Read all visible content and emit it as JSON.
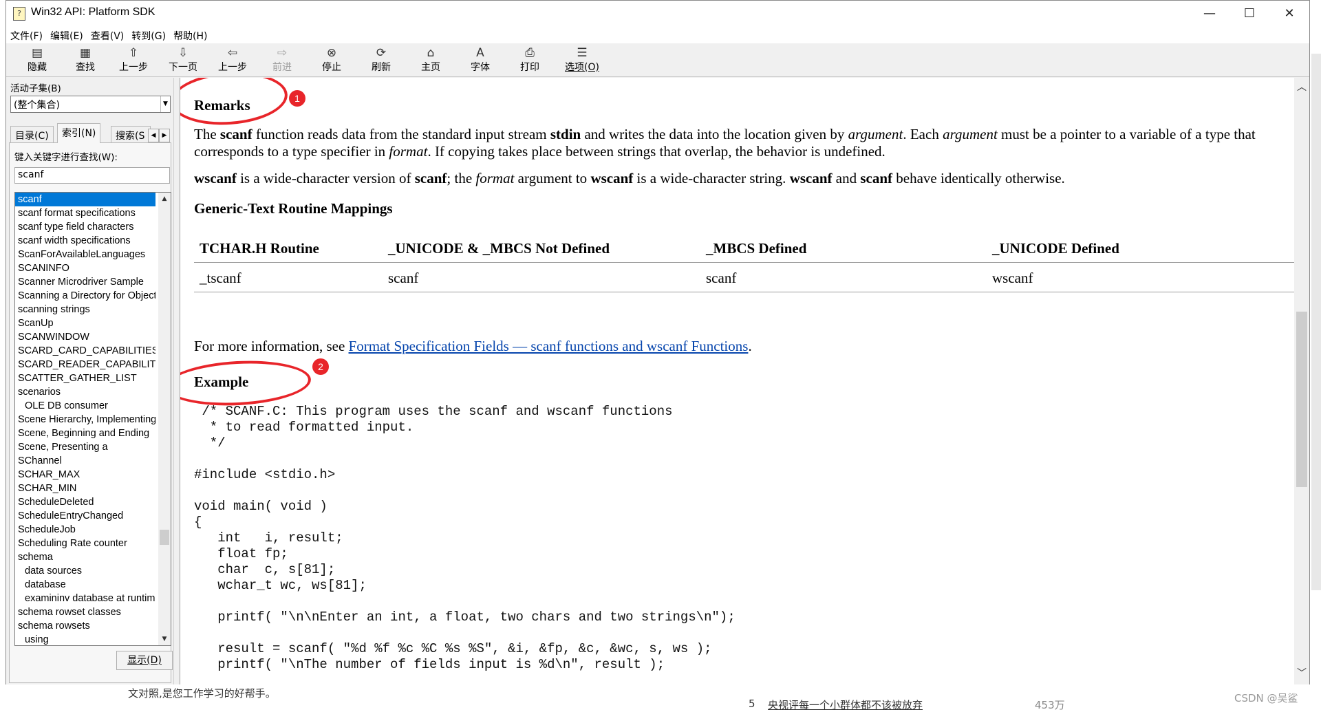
{
  "window": {
    "title": "Win32 API: Platform SDK",
    "controls": {
      "minimize": "—",
      "maximize": "☐",
      "close": "✕"
    }
  },
  "menu": [
    "文件(F)",
    "编辑(E)",
    "查看(V)",
    "转到(G)",
    "帮助(H)"
  ],
  "toolbar": [
    {
      "label": "隐藏",
      "icon": "hide-icon"
    },
    {
      "label": "查找",
      "icon": "locate-icon"
    },
    {
      "label": "上一步",
      "icon": "back-arrow-icon"
    },
    {
      "label": "下一页",
      "icon": "next-page-icon"
    },
    {
      "label": "上一步",
      "icon": "back-icon"
    },
    {
      "label": "前进",
      "icon": "forward-icon",
      "disabled": true
    },
    {
      "label": "停止",
      "icon": "stop-icon"
    },
    {
      "label": "刷新",
      "icon": "refresh-icon"
    },
    {
      "label": "主页",
      "icon": "home-icon"
    },
    {
      "label": "字体",
      "icon": "font-icon"
    },
    {
      "label": "打印",
      "icon": "print-icon"
    },
    {
      "label": "选项(O)",
      "icon": "options-icon"
    }
  ],
  "left": {
    "subset_label": "活动子集(B)",
    "subset_value": "(整个集合)",
    "tabs": [
      "目录(C)",
      "索引(N)",
      "搜索(S"
    ],
    "keyword_label": "键入关键字进行查找(W):",
    "keyword_value": "scanf",
    "index_items": [
      {
        "text": "scanf",
        "selected": true
      },
      {
        "text": "scanf format specifications"
      },
      {
        "text": "scanf type field characters"
      },
      {
        "text": "scanf width specifications"
      },
      {
        "text": "ScanForAvailableLanguages"
      },
      {
        "text": "SCANINFO"
      },
      {
        "text": "Scanner Microdriver Sample"
      },
      {
        "text": "Scanning a Directory for Objects"
      },
      {
        "text": "scanning strings"
      },
      {
        "text": "ScanUp"
      },
      {
        "text": "SCANWINDOW"
      },
      {
        "text": "SCARD_CARD_CAPABILITIES"
      },
      {
        "text": "SCARD_READER_CAPABILITIES"
      },
      {
        "text": "SCATTER_GATHER_LIST"
      },
      {
        "text": "scenarios"
      },
      {
        "text": "OLE DB consumer",
        "indent": true
      },
      {
        "text": "Scene Hierarchy, Implementing"
      },
      {
        "text": "Scene, Beginning and Ending"
      },
      {
        "text": "Scene, Presenting a"
      },
      {
        "text": "SChannel"
      },
      {
        "text": "SCHAR_MAX"
      },
      {
        "text": "SCHAR_MIN"
      },
      {
        "text": "ScheduleDeleted"
      },
      {
        "text": "ScheduleEntryChanged"
      },
      {
        "text": "ScheduleJob"
      },
      {
        "text": "Scheduling Rate counter"
      },
      {
        "text": "schema"
      },
      {
        "text": "data sources",
        "indent": true
      },
      {
        "text": "database",
        "indent": true
      },
      {
        "text": "examininv database at runtime",
        "indent": true
      },
      {
        "text": "schema rowset classes"
      },
      {
        "text": "schema rowsets"
      },
      {
        "text": "using",
        "indent": true
      }
    ],
    "show_button": "显示(D)"
  },
  "content": {
    "remarks_heading": "Remarks",
    "remarks_p1": [
      {
        "t": "The "
      },
      {
        "t": "scanf",
        "b": true
      },
      {
        "t": " function reads data from the standard input stream "
      },
      {
        "t": "stdin",
        "b": true
      },
      {
        "t": " and writes the data into the location given by "
      },
      {
        "t": "argument",
        "i": true
      },
      {
        "t": ". Each "
      },
      {
        "t": "argument",
        "i": true
      },
      {
        "t": " must be a pointer to a variable of a type that corresponds to a type specifier in "
      },
      {
        "t": "format",
        "i": true
      },
      {
        "t": ". If copying takes place between strings that overlap, the behavior is undefined."
      }
    ],
    "remarks_p2": [
      {
        "t": "wscanf",
        "b": true
      },
      {
        "t": " is a wide-character version of "
      },
      {
        "t": "scanf",
        "b": true
      },
      {
        "t": "; the "
      },
      {
        "t": "format",
        "i": true
      },
      {
        "t": " argument to "
      },
      {
        "t": "wscanf",
        "b": true
      },
      {
        "t": " is a wide-character string. "
      },
      {
        "t": "wscanf",
        "b": true
      },
      {
        "t": " and "
      },
      {
        "t": "scanf",
        "b": true
      },
      {
        "t": " behave identically otherwise."
      }
    ],
    "mappings_heading": "Generic-Text Routine Mappings",
    "table": {
      "headers": [
        "TCHAR.H Routine",
        "_UNICODE & _MBCS Not Defined",
        "_MBCS Defined",
        "_UNICODE Defined"
      ],
      "rows": [
        [
          "_tscanf",
          "scanf",
          "scanf",
          "wscanf"
        ]
      ]
    },
    "more_info_prefix": "For more information, see ",
    "more_info_link": "Format Specification Fields — scanf functions and wscanf Functions",
    "more_info_suffix": ".",
    "example_heading": "Example",
    "code": " /* SCANF.C: This program uses the scanf and wscanf functions\n  * to read formatted input.\n  */\n\n#include <stdio.h>\n\nvoid main( void )\n{\n   int   i, result;\n   float fp;\n   char  c, s[81];\n   wchar_t wc, ws[81];\n\n   printf( \"\\n\\nEnter an int, a float, two chars and two strings\\n\");\n\n   result = scanf( \"%d %f %c %C %s %S\", &i, &fp, &c, &wc, s, ws );\n   printf( \"\\nThe number of fields input is %d\\n\", result );"
  },
  "annotations": {
    "badge1": "1",
    "badge2": "2",
    "color": "#e8252a"
  },
  "below": {
    "caption": "文对照,是您工作学习的好帮手。",
    "news_num": "5",
    "news_text": "央视评每一个小群体都不该被放弃",
    "news_count": "453万",
    "watermark": "CSDN @吴鲨"
  }
}
